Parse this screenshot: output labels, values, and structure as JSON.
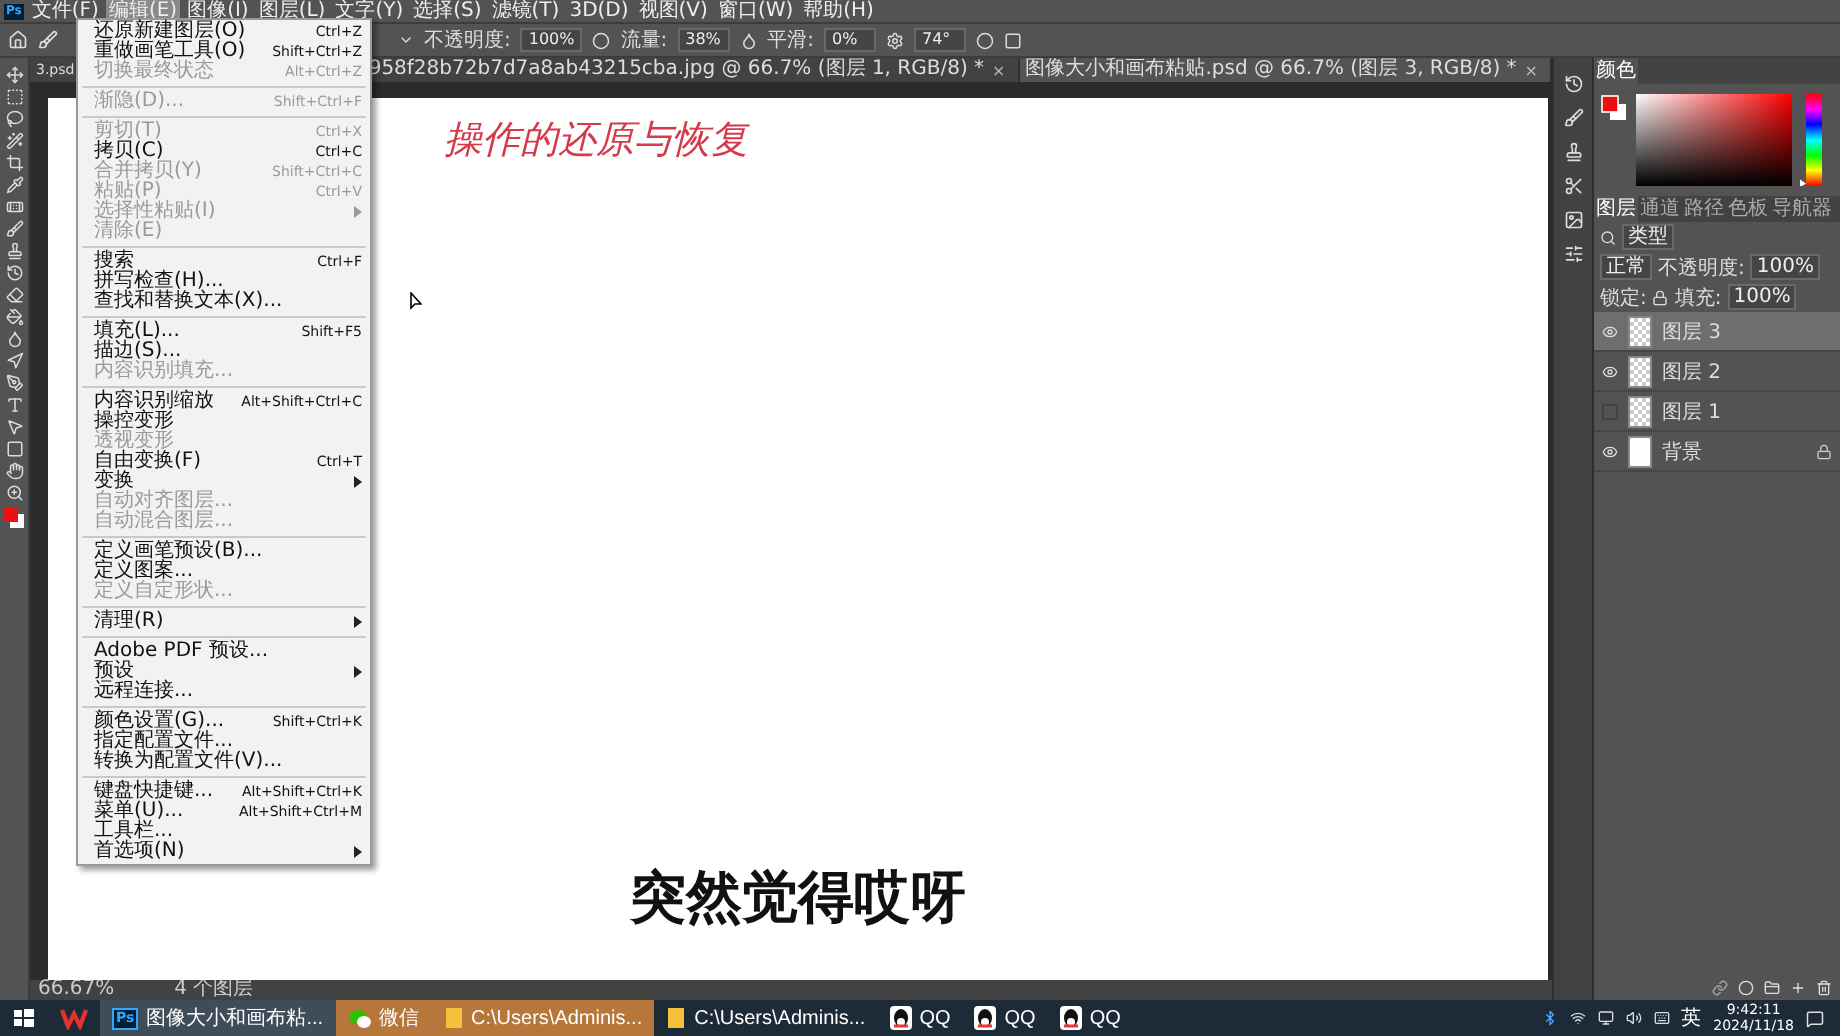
{
  "menubar": {
    "app_logo": "Ps",
    "items": [
      {
        "label": "文件(F)",
        "selected": false
      },
      {
        "label": "编辑(E)",
        "selected": true
      },
      {
        "label": "图像(I)",
        "selected": false
      },
      {
        "label": "图层(L)",
        "selected": false
      },
      {
        "label": "文字(Y)",
        "selected": false
      },
      {
        "label": "选择(S)",
        "selected": false
      },
      {
        "label": "滤镜(T)",
        "selected": false
      },
      {
        "label": "3D(D)",
        "selected": false
      },
      {
        "label": "视图(V)",
        "selected": false
      },
      {
        "label": "窗口(W)",
        "selected": false
      },
      {
        "label": "帮助(H)",
        "selected": false
      }
    ]
  },
  "options_bar": {
    "opacity_label": "不透明度:",
    "opacity": "100%",
    "flow_label": "流量:",
    "flow": "38%",
    "smoothing_label": "平滑:",
    "smoothing": "0%",
    "angle": "74°"
  },
  "document_tabs": [
    {
      "title": "3.psd",
      "selected": false
    },
    {
      "title": "958f28b72b7d7a8ab43215cba.jpg @ 66.7% (图层 1, RGB/8) *",
      "close": "×",
      "selected": false
    },
    {
      "title": "图像大小和画布粘贴.psd @ 66.7% (图层 3, RGB/8) *",
      "close": "×",
      "selected": true
    }
  ],
  "canvas": {
    "handwriting": "操作的还原与恢复",
    "subtitle": "突然觉得哎呀"
  },
  "status_bar": {
    "zoom": "66.67%",
    "info": "4 个图层"
  },
  "edit_menu": {
    "groups": [
      [
        {
          "label": "还原新建图层(O)",
          "shortcut": "Ctrl+Z",
          "disabled": false,
          "submenu": false
        },
        {
          "label": "重做画笔工具(O)",
          "shortcut": "Shift+Ctrl+Z",
          "disabled": false,
          "submenu": false
        },
        {
          "label": "切换最终状态",
          "shortcut": "Alt+Ctrl+Z",
          "disabled": true,
          "submenu": false
        }
      ],
      [
        {
          "label": "渐隐(D)...",
          "shortcut": "Shift+Ctrl+F",
          "disabled": true,
          "submenu": false
        }
      ],
      [
        {
          "label": "剪切(T)",
          "shortcut": "Ctrl+X",
          "disabled": true,
          "submenu": false
        },
        {
          "label": "拷贝(C)",
          "shortcut": "Ctrl+C",
          "disabled": false,
          "submenu": false
        },
        {
          "label": "合并拷贝(Y)",
          "shortcut": "Shift+Ctrl+C",
          "disabled": true,
          "submenu": false
        },
        {
          "label": "粘贴(P)",
          "shortcut": "Ctrl+V",
          "disabled": true,
          "submenu": false
        },
        {
          "label": "选择性粘贴(I)",
          "disabled": true,
          "submenu": true
        },
        {
          "label": "清除(E)",
          "disabled": true,
          "submenu": false
        }
      ],
      [
        {
          "label": "搜索",
          "shortcut": "Ctrl+F",
          "disabled": false,
          "submenu": false
        },
        {
          "label": "拼写检查(H)...",
          "disabled": false,
          "submenu": false
        },
        {
          "label": "查找和替换文本(X)...",
          "disabled": false,
          "submenu": false
        }
      ],
      [
        {
          "label": "填充(L)...",
          "shortcut": "Shift+F5",
          "disabled": false,
          "submenu": false
        },
        {
          "label": "描边(S)...",
          "disabled": false,
          "submenu": false
        },
        {
          "label": "内容识别填充...",
          "disabled": true,
          "submenu": false
        }
      ],
      [
        {
          "label": "内容识别缩放",
          "shortcut": "Alt+Shift+Ctrl+C",
          "disabled": false,
          "submenu": false
        },
        {
          "label": "操控变形",
          "disabled": false,
          "submenu": false
        },
        {
          "label": "透视变形",
          "disabled": true,
          "submenu": false
        },
        {
          "label": "自由变换(F)",
          "shortcut": "Ctrl+T",
          "disabled": false,
          "submenu": false
        },
        {
          "label": "变换",
          "disabled": false,
          "submenu": true
        },
        {
          "label": "自动对齐图层...",
          "disabled": true,
          "submenu": false
        },
        {
          "label": "自动混合图层...",
          "disabled": true,
          "submenu": false
        }
      ],
      [
        {
          "label": "定义画笔预设(B)...",
          "disabled": false,
          "submenu": false
        },
        {
          "label": "定义图案...",
          "disabled": false,
          "submenu": false
        },
        {
          "label": "定义自定形状...",
          "disabled": true,
          "submenu": false
        }
      ],
      [
        {
          "label": "清理(R)",
          "disabled": false,
          "submenu": true
        }
      ],
      [
        {
          "label": "Adobe PDF 预设...",
          "disabled": false,
          "submenu": false
        },
        {
          "label": "预设",
          "disabled": false,
          "submenu": true
        },
        {
          "label": "远程连接...",
          "disabled": false,
          "submenu": false
        }
      ],
      [
        {
          "label": "颜色设置(G)...",
          "shortcut": "Shift+Ctrl+K",
          "disabled": false,
          "submenu": false
        },
        {
          "label": "指定配置文件...",
          "disabled": false,
          "submenu": false
        },
        {
          "label": "转换为配置文件(V)...",
          "disabled": false,
          "submenu": false
        }
      ],
      [
        {
          "label": "键盘快捷键...",
          "shortcut": "Alt+Shift+Ctrl+K",
          "disabled": false,
          "submenu": false
        },
        {
          "label": "菜单(U)...",
          "shortcut": "Alt+Shift+Ctrl+M",
          "disabled": false,
          "submenu": false
        },
        {
          "label": "工具栏...",
          "disabled": false,
          "submenu": false
        },
        {
          "label": "首选项(N)",
          "disabled": false,
          "submenu": true
        }
      ]
    ]
  },
  "color_panel": {
    "title": "颜色",
    "hue_slider": {
      "level": 0.03
    }
  },
  "layers_panel": {
    "tabs": [
      {
        "label": "图层",
        "selected": true
      },
      {
        "label": "通道",
        "selected": false
      },
      {
        "label": "路径",
        "selected": false
      },
      {
        "label": "色板",
        "selected": false
      },
      {
        "label": "导航器",
        "selected": false
      }
    ],
    "filter": "类型",
    "blend_mode": "正常",
    "opacity_label": "不透明度:",
    "opacity": "100%",
    "lock_label": "锁定:",
    "fill_label": "填充:",
    "fill": "100%",
    "layers": [
      {
        "name": "图层 3",
        "kind": "transparent",
        "visible": true,
        "selected": true,
        "locked": false
      },
      {
        "name": "图层 2",
        "kind": "transparent",
        "visible": true,
        "selected": false,
        "locked": false
      },
      {
        "name": "图层 1",
        "kind": "transparent",
        "visible": false,
        "selected": false,
        "locked": false
      },
      {
        "name": "背景",
        "kind": "background",
        "visible": true,
        "selected": false,
        "locked": true
      }
    ]
  },
  "taskbar": {
    "items": [
      {
        "kind": "wps",
        "selected": false,
        "flashing": false
      },
      {
        "kind": "photoshop",
        "badge": "Ps",
        "label": "图像大小和画布粘...",
        "selected": true,
        "flashing": false
      },
      {
        "kind": "wechat",
        "label": "微信",
        "selected": false,
        "flashing": true
      },
      {
        "kind": "folder",
        "label": "C:\\Users\\Adminis...",
        "selected": false,
        "flashing": true
      },
      {
        "kind": "folder",
        "label": "C:\\Users\\Adminis...",
        "selected": false,
        "flashing": false
      },
      {
        "kind": "qq",
        "label": "QQ",
        "selected": false,
        "flashing": false
      },
      {
        "kind": "qq",
        "label": "QQ",
        "selected": false,
        "flashing": false
      },
      {
        "kind": "qq",
        "label": "QQ",
        "selected": false,
        "flashing": false
      }
    ],
    "ime": "英",
    "time": "9:42:11",
    "date": "2024/11/18"
  }
}
